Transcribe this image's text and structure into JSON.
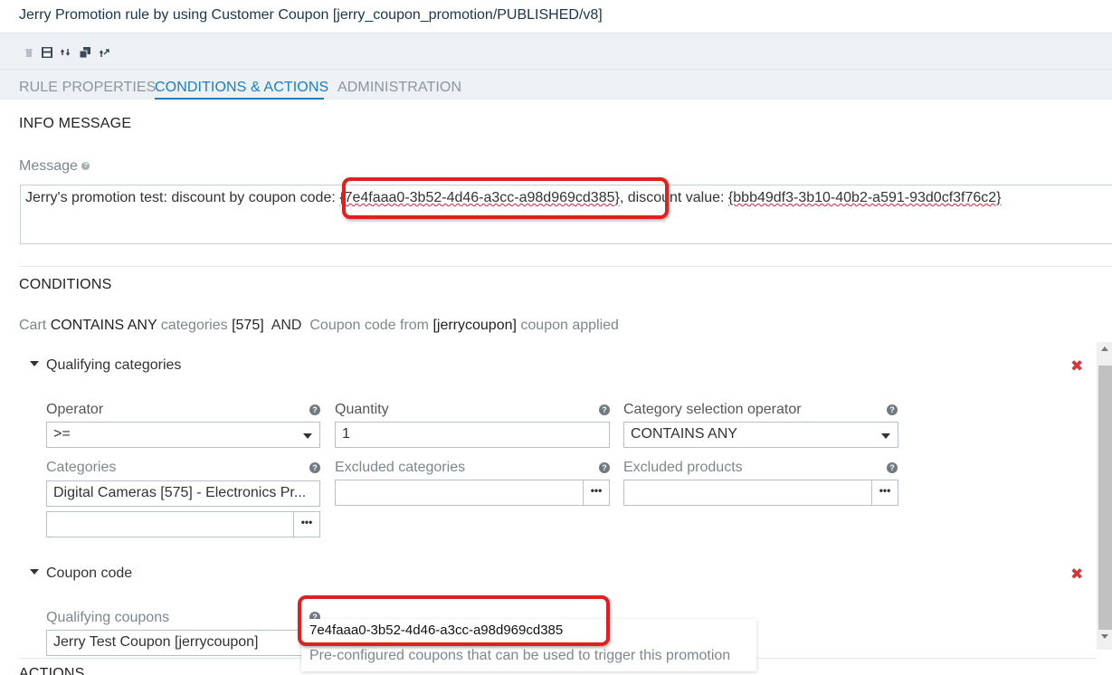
{
  "window": {
    "title": "Jerry Promotion rule by using Customer Coupon [jerry_coupon_promotion/PUBLISHED/v8]"
  },
  "toolbar": {
    "icons": [
      "delete-icon",
      "save-icon",
      "sync-icon",
      "clone-icon",
      "compare-icon"
    ]
  },
  "tabs": [
    {
      "label": "RULE PROPERTIES",
      "active": false
    },
    {
      "label": "CONDITIONS & ACTIONS",
      "active": true
    },
    {
      "label": "ADMINISTRATION",
      "active": false
    }
  ],
  "info_message": {
    "section_title": "INFO MESSAGE",
    "message_label": "Message",
    "message_prefix": "Jerry's promotion test: discount by coupon code: ",
    "coupon_token": "{7e4faaa0-3b52-4d46-a3cc-a98d969cd385}",
    "message_mid": ",  discount value: ",
    "discount_token": "{bbb49df3-3b10-40b2-a591-93d0cf3f76c2}"
  },
  "conditions": {
    "section_title": "CONDITIONS",
    "summary": {
      "w1": "Cart",
      "w2": "CONTAINS ANY",
      "w3": "categories",
      "w4": "[575]",
      "w5": "AND",
      "w6": "Coupon code from",
      "w7": "[jerrycoupon]",
      "w8": "coupon applied"
    },
    "qualifying_categories": {
      "title": "Qualifying categories",
      "operator_label": "Operator",
      "operator_value": ">=",
      "quantity_label": "Quantity",
      "quantity_value": "1",
      "cat_sel_label": "Category selection operator",
      "cat_sel_value": "CONTAINS ANY",
      "categories_label": "Categories",
      "categories_value": "Digital Cameras [575] - Electronics Pr...",
      "excluded_categories_label": "Excluded categories",
      "excluded_products_label": "Excluded products"
    },
    "coupon_code": {
      "title": "Coupon code",
      "qualifying_coupons_label": "Qualifying coupons",
      "qualifying_coupons_value": "Jerry Test Coupon [jerrycoupon]"
    }
  },
  "tooltip": {
    "code": "7e4faaa0-3b52-4d46-a3cc-a98d969cd385",
    "description": "Pre-configured coupons that can be used to trigger this promotion"
  },
  "actions": {
    "section_title": "ACTIONS"
  },
  "remove_symbol": "✖",
  "dots": "•••",
  "help_symbol": "?"
}
